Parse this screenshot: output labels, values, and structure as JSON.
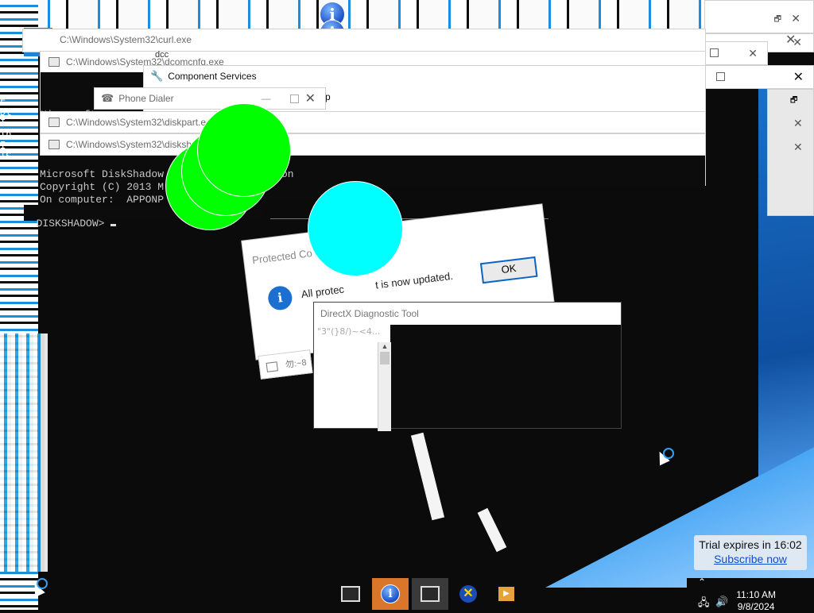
{
  "windows": {
    "curl": {
      "title": "C:\\Windows\\System32\\curl.exe"
    },
    "dcomcnfg": {
      "title": "C:\\Windows\\System32\\dcomcnfg.exe",
      "partial": "dcc"
    },
    "component_services": {
      "title": "Component Services",
      "partial_menu": "p"
    },
    "phone_dialer": {
      "title": "Phone Dialer"
    },
    "diskpart": {
      "title": "C:\\Windows\\System32\\diskpart.e"
    },
    "diskshadow": {
      "title": "C:\\Windows\\System32\\disksh",
      "console_line1": "Microsoft DiskShadow",
      "console_line1b": "on",
      "console_line2": "Copyright (C) 2013 M",
      "console_line3": "On computer:  APPONP",
      "prompt": "DISKSHADOW> "
    },
    "bg_console": {
      "text": "Microsoft"
    }
  },
  "dialog": {
    "title": "Protected Co",
    "message": "All protec           t is now updated.",
    "ok_label": "OK"
  },
  "directx": {
    "title": "DirectX Diagnostic Tool",
    "garbled": "\"3\"(}8/)~<4..."
  },
  "side_glitch_text": "E\nDt\nI\nIn\nI\nIS",
  "small_tile_text": "勿:~8",
  "trial": {
    "line1": "Trial expires in 16:02",
    "link": "Subscribe now"
  },
  "clock": {
    "time": "11:10 AM",
    "date": "9/8/2024"
  },
  "taskbar": {
    "items": [
      {
        "name": "console-window"
      },
      {
        "name": "info-app",
        "active": true
      },
      {
        "name": "console-window-2"
      },
      {
        "name": "x-app"
      },
      {
        "name": "media-app"
      }
    ]
  },
  "colors": {
    "accent": "#1e83d6",
    "green_blob": "#00ff00",
    "cyan_blob": "#00ffff",
    "active_task": "#d9762a"
  }
}
